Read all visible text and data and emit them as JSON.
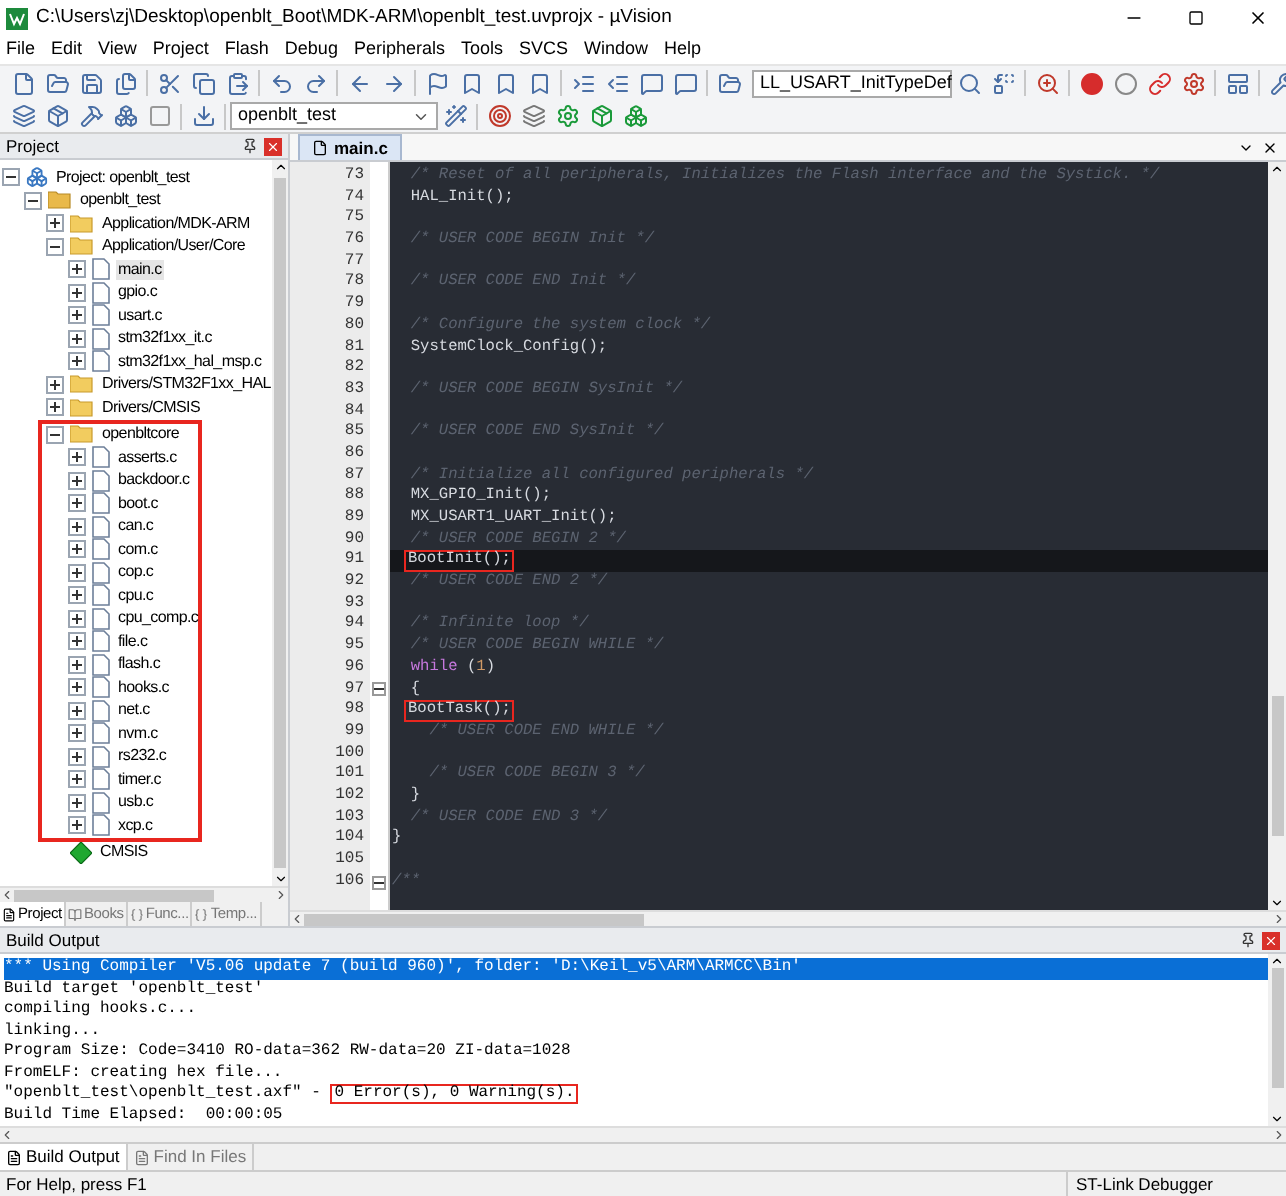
{
  "window": {
    "title": "C:\\Users\\zj\\Desktop\\openblt_Boot\\MDK-ARM\\openblt_test.uvprojx - µVision"
  },
  "menu": [
    "File",
    "Edit",
    "View",
    "Project",
    "Flash",
    "Debug",
    "Peripherals",
    "Tools",
    "SVCS",
    "Window",
    "Help"
  ],
  "toolbar": {
    "find_combo": "LL_USART_InitTypeDef",
    "target_combo": "openblt_test"
  },
  "project_panel": {
    "title": "Project",
    "tree": [
      {
        "kind": "project",
        "label": "Project: openblt_test",
        "expanded": true,
        "selected": false,
        "children": [
          {
            "kind": "target",
            "label": "openblt_test",
            "expanded": true,
            "selected": false,
            "children": [
              {
                "kind": "group",
                "label": "Application/MDK-ARM",
                "expanded": false,
                "selected": false
              },
              {
                "kind": "group",
                "label": "Application/User/Core",
                "expanded": true,
                "selected": false,
                "children": [
                  {
                    "kind": "file",
                    "label": "main.c",
                    "expanded": false,
                    "selected": true
                  },
                  {
                    "kind": "file",
                    "label": "gpio.c",
                    "expanded": false,
                    "selected": false
                  },
                  {
                    "kind": "file",
                    "label": "usart.c",
                    "expanded": false,
                    "selected": false
                  },
                  {
                    "kind": "file",
                    "label": "stm32f1xx_it.c",
                    "expanded": false,
                    "selected": false
                  },
                  {
                    "kind": "file",
                    "label": "stm32f1xx_hal_msp.c",
                    "expanded": false,
                    "selected": false
                  }
                ]
              },
              {
                "kind": "group",
                "label": "Drivers/STM32F1xx_HAL",
                "expanded": false,
                "selected": false
              },
              {
                "kind": "group",
                "label": "Drivers/CMSIS",
                "expanded": false,
                "selected": false
              },
              {
                "kind": "group",
                "label": "openbltcore",
                "expanded": true,
                "selected": false,
                "highlighted": true,
                "children": [
                  {
                    "kind": "file",
                    "label": "asserts.c",
                    "expanded": false,
                    "selected": false
                  },
                  {
                    "kind": "file",
                    "label": "backdoor.c",
                    "expanded": false,
                    "selected": false
                  },
                  {
                    "kind": "file",
                    "label": "boot.c",
                    "expanded": false,
                    "selected": false
                  },
                  {
                    "kind": "file",
                    "label": "can.c",
                    "expanded": false,
                    "selected": false
                  },
                  {
                    "kind": "file",
                    "label": "com.c",
                    "expanded": false,
                    "selected": false
                  },
                  {
                    "kind": "file",
                    "label": "cop.c",
                    "expanded": false,
                    "selected": false
                  },
                  {
                    "kind": "file",
                    "label": "cpu.c",
                    "expanded": false,
                    "selected": false
                  },
                  {
                    "kind": "file",
                    "label": "cpu_comp.c",
                    "expanded": false,
                    "selected": false
                  },
                  {
                    "kind": "file",
                    "label": "file.c",
                    "expanded": false,
                    "selected": false
                  },
                  {
                    "kind": "file",
                    "label": "flash.c",
                    "expanded": false,
                    "selected": false
                  },
                  {
                    "kind": "file",
                    "label": "hooks.c",
                    "expanded": false,
                    "selected": false
                  },
                  {
                    "kind": "file",
                    "label": "net.c",
                    "expanded": false,
                    "selected": false
                  },
                  {
                    "kind": "file",
                    "label": "nvm.c",
                    "expanded": false,
                    "selected": false
                  },
                  {
                    "kind": "file",
                    "label": "rs232.c",
                    "expanded": false,
                    "selected": false
                  },
                  {
                    "kind": "file",
                    "label": "timer.c",
                    "expanded": false,
                    "selected": false
                  },
                  {
                    "kind": "file",
                    "label": "usb.c",
                    "expanded": false,
                    "selected": false
                  },
                  {
                    "kind": "file",
                    "label": "xcp.c",
                    "expanded": false,
                    "selected": false
                  }
                ]
              },
              {
                "kind": "component",
                "label": "CMSIS",
                "selected": false
              }
            ]
          }
        ]
      }
    ],
    "tabs": [
      {
        "label": "Project",
        "selected": true
      },
      {
        "label": "Books",
        "selected": false
      },
      {
        "label": "Func...",
        "selected": false
      },
      {
        "label": "Temp...",
        "selected": false
      }
    ]
  },
  "editor": {
    "tab": "main.c",
    "lines": [
      {
        "num": "73",
        "parts": [
          {
            "kind": "comment",
            "text": "  /* Reset of all peripherals, Initializes the Flash interface and the Systick. */"
          }
        ]
      },
      {
        "num": "74",
        "parts": [
          {
            "kind": "code",
            "text": "  HAL_Init();"
          }
        ]
      },
      {
        "num": "75"
      },
      {
        "num": "76",
        "parts": [
          {
            "kind": "comment",
            "text": "  /* USER CODE BEGIN Init */"
          }
        ]
      },
      {
        "num": "77"
      },
      {
        "num": "78",
        "parts": [
          {
            "kind": "comment",
            "text": "  /* USER CODE END Init */"
          }
        ]
      },
      {
        "num": "79"
      },
      {
        "num": "80",
        "parts": [
          {
            "kind": "comment",
            "text": "  /* Configure the system clock */"
          }
        ]
      },
      {
        "num": "81",
        "parts": [
          {
            "kind": "code",
            "text": "  SystemClock_Config();"
          }
        ]
      },
      {
        "num": "82"
      },
      {
        "num": "83",
        "parts": [
          {
            "kind": "comment",
            "text": "  /* USER CODE BEGIN SysInit */"
          }
        ]
      },
      {
        "num": "84"
      },
      {
        "num": "85",
        "parts": [
          {
            "kind": "comment",
            "text": "  /* USER CODE END SysInit */"
          }
        ]
      },
      {
        "num": "86"
      },
      {
        "num": "87",
        "parts": [
          {
            "kind": "comment",
            "text": "  /* Initialize all configured peripherals */"
          }
        ]
      },
      {
        "num": "88",
        "parts": [
          {
            "kind": "code",
            "text": "  MX_GPIO_Init();"
          }
        ]
      },
      {
        "num": "89",
        "parts": [
          {
            "kind": "code",
            "text": "  MX_USART1_UART_Init();"
          }
        ]
      },
      {
        "num": "90",
        "parts": [
          {
            "kind": "comment",
            "text": "  /* USER CODE BEGIN 2 */"
          }
        ]
      },
      {
        "num": "91",
        "current": true,
        "parts": [
          {
            "kind": "code",
            "text": "BootInit();",
            "highlighted": true
          }
        ]
      },
      {
        "num": "92",
        "parts": [
          {
            "kind": "comment",
            "text": "  /* USER CODE END 2 */"
          }
        ]
      },
      {
        "num": "93"
      },
      {
        "num": "94",
        "parts": [
          {
            "kind": "comment",
            "text": "  /* Infinite loop */"
          }
        ]
      },
      {
        "num": "95",
        "parts": [
          {
            "kind": "comment",
            "text": "  /* USER CODE BEGIN WHILE */"
          }
        ]
      },
      {
        "num": "96",
        "parts": [
          {
            "kind": "keyword",
            "text": "  while"
          },
          {
            "kind": "code",
            "text": " ("
          },
          {
            "kind": "number",
            "text": "1"
          },
          {
            "kind": "code",
            "text": ")"
          }
        ]
      },
      {
        "num": "97",
        "fold": true,
        "parts": [
          {
            "kind": "code",
            "text": "  {"
          }
        ]
      },
      {
        "num": "98",
        "parts": [
          {
            "kind": "code",
            "text": "BootTask();",
            "highlighted": true
          }
        ]
      },
      {
        "num": "99",
        "parts": [
          {
            "kind": "comment",
            "text": "    /* USER CODE END WHILE */"
          }
        ]
      },
      {
        "num": "100"
      },
      {
        "num": "101",
        "parts": [
          {
            "kind": "comment",
            "text": "    /* USER CODE BEGIN 3 */"
          }
        ]
      },
      {
        "num": "102",
        "parts": [
          {
            "kind": "code",
            "text": "  }"
          }
        ]
      },
      {
        "num": "103",
        "parts": [
          {
            "kind": "comment",
            "text": "  /* USER CODE END 3 */"
          }
        ]
      },
      {
        "num": "104",
        "parts": [
          {
            "kind": "code",
            "text": "}"
          }
        ]
      },
      {
        "num": "105"
      },
      {
        "num": "106",
        "fold": true,
        "parts": [
          {
            "kind": "comment",
            "text": "/**"
          }
        ]
      }
    ]
  },
  "build_output": {
    "title": "Build Output",
    "lines": [
      {
        "selected": true,
        "parts": [
          {
            "text": "*** Using Compiler 'V5.06 update 7 (build 960)', folder: 'D:\\Keil_v5\\ARM\\ARMCC\\Bin'"
          }
        ]
      },
      {
        "selected": false,
        "parts": [
          {
            "text": "Build target 'openblt_test'"
          }
        ]
      },
      {
        "selected": false,
        "parts": [
          {
            "text": "compiling hooks.c..."
          }
        ]
      },
      {
        "selected": false,
        "parts": [
          {
            "text": "linking..."
          }
        ]
      },
      {
        "selected": false,
        "parts": [
          {
            "text": "Program Size: Code=3410 RO-data=362 RW-data=20 ZI-data=1028"
          }
        ]
      },
      {
        "selected": false,
        "parts": [
          {
            "text": "FromELF: creating hex file..."
          }
        ]
      },
      {
        "selected": false,
        "parts": [
          {
            "text": "\"openblt_test\\openblt_test.axf\" - "
          },
          {
            "text": "0 Error(s), 0 Warning(s).",
            "highlighted": true
          }
        ]
      },
      {
        "selected": false,
        "parts": [
          {
            "text": "Build Time Elapsed:  00:00:05"
          }
        ]
      }
    ],
    "tabs": [
      {
        "label": "Build Output",
        "selected": true
      },
      {
        "label": "Find In Files",
        "selected": false
      }
    ]
  },
  "status_bar": {
    "help": "For Help, press F1",
    "debugger": "ST-Link Debugger"
  }
}
